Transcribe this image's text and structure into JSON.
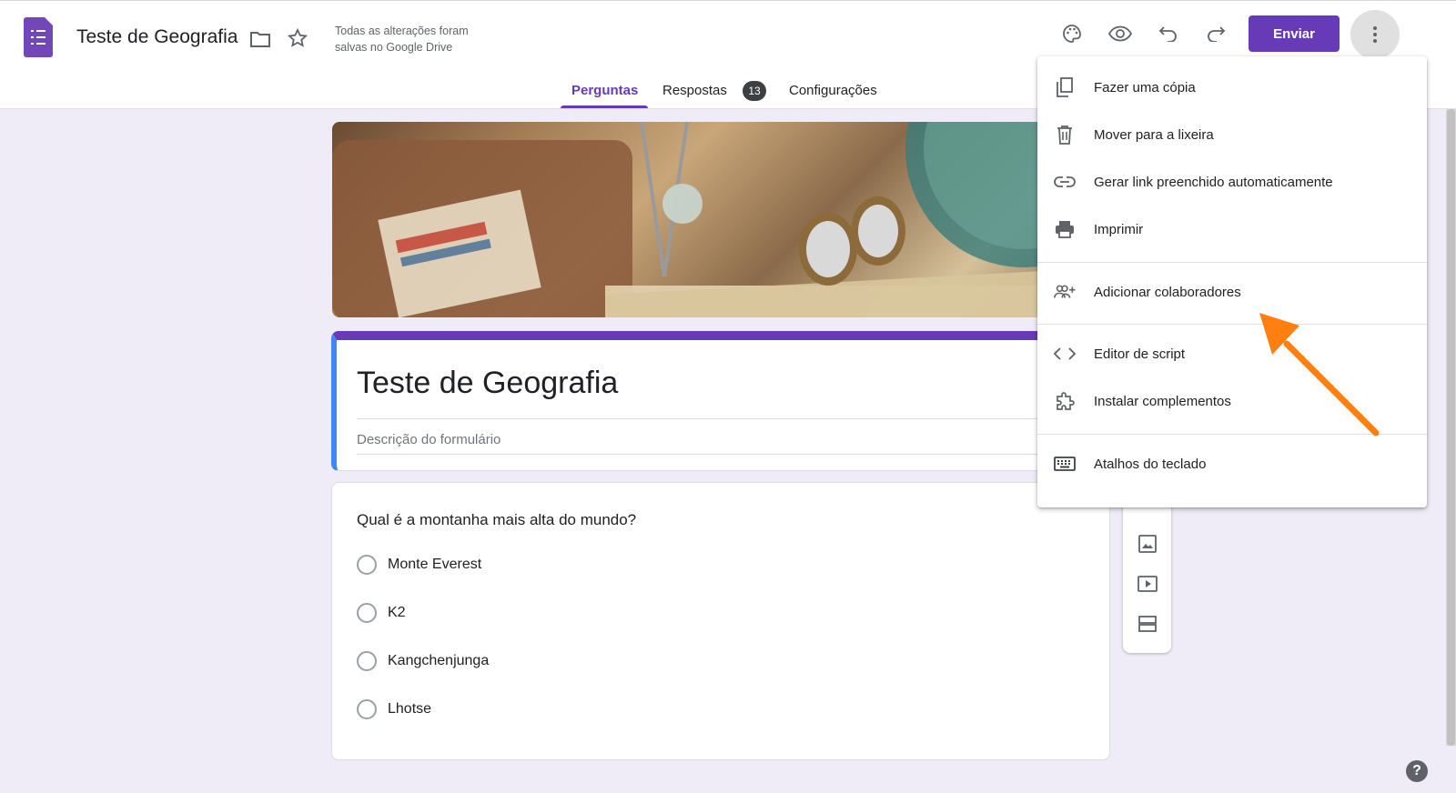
{
  "header": {
    "doc_title": "Teste de Geografia",
    "save_status_line1": "Todas as alterações foram",
    "save_status_line2": "salvas no Google Drive",
    "send_label": "Enviar",
    "icons": [
      "forms-app-icon",
      "folder-icon",
      "star-icon",
      "palette-icon",
      "eye-icon",
      "undo-icon",
      "redo-icon",
      "more-vert-icon"
    ]
  },
  "tabs": [
    {
      "label": "Perguntas",
      "active": true
    },
    {
      "label": "Respostas",
      "badge": "13"
    },
    {
      "label": "Configurações"
    }
  ],
  "form": {
    "title": "Teste de Geografia",
    "description_placeholder": "Descrição do formulário"
  },
  "question": {
    "text": "Qual é a montanha mais alta do mundo?",
    "options": [
      "Monte Everest",
      "K2",
      "Kangchenjunga",
      "Lhotse"
    ]
  },
  "menu": {
    "items": [
      {
        "label": "Fazer uma cópia",
        "icon": "copy-icon"
      },
      {
        "label": "Mover para a lixeira",
        "icon": "trash-icon"
      },
      {
        "label": "Gerar link preenchido automaticamente",
        "icon": "link-icon"
      },
      {
        "label": "Imprimir",
        "icon": "print-icon"
      },
      {
        "label": "Adicionar colaboradores",
        "icon": "add-people-icon"
      },
      {
        "label": "Editor de script",
        "icon": "code-icon"
      },
      {
        "label": "Instalar complementos",
        "icon": "puzzle-icon"
      },
      {
        "label": "Atalhos do teclado",
        "icon": "keyboard-icon"
      }
    ]
  },
  "colors": {
    "accent": "#673ab7",
    "annotation_arrow": "#ff7f11",
    "background": "#efebf7"
  },
  "help": {
    "label": "?"
  }
}
